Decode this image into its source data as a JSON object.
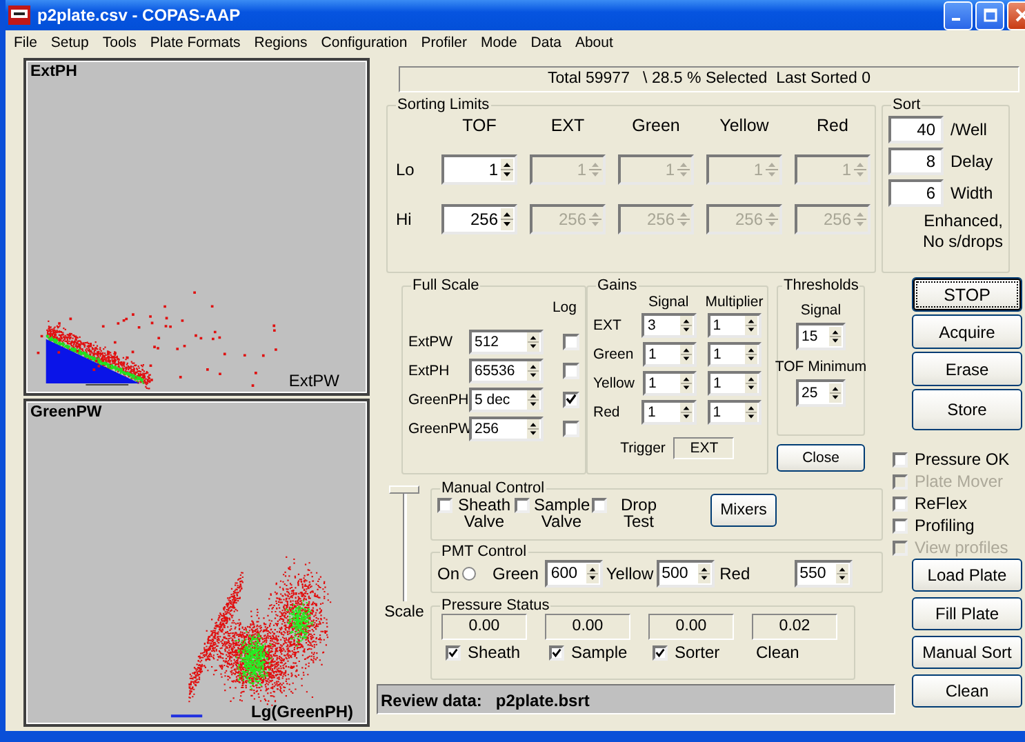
{
  "window": {
    "title": "p2plate.csv - COPAS-AAP"
  },
  "menu": [
    "File",
    "Setup",
    "Tools",
    "Plate Formats",
    "Regions",
    "Configuration",
    "Profiler",
    "Mode",
    "Data",
    "About"
  ],
  "plots": [
    {
      "kind": "wedge",
      "y_label": "ExtPH",
      "x_label": "ExtPW"
    },
    {
      "kind": "clusters",
      "y_label": "GreenPW",
      "x_label": "Lg(GreenPH)"
    }
  ],
  "status": "Total 59977   \\ 28.5 % Selected  Last Sorted 0",
  "sorting_limits": {
    "title": "Sorting Limits",
    "row_labels": [
      "Lo",
      "Hi"
    ],
    "columns": [
      {
        "label": "TOF",
        "lo": "1",
        "hi": "256",
        "disabled": false
      },
      {
        "label": "EXT",
        "lo": "1",
        "hi": "256",
        "disabled": true
      },
      {
        "label": "Green",
        "lo": "1",
        "hi": "256",
        "disabled": true
      },
      {
        "label": "Yellow",
        "lo": "1",
        "hi": "256",
        "disabled": true
      },
      {
        "label": "Red",
        "lo": "1",
        "hi": "256",
        "disabled": true
      }
    ]
  },
  "sort": {
    "title": "Sort",
    "fields": [
      {
        "value": "40",
        "label": "/Well"
      },
      {
        "value": "8",
        "label": "Delay"
      },
      {
        "value": "6",
        "label": "Width"
      }
    ],
    "note": "Enhanced, No s/drops"
  },
  "full_scale": {
    "title": "Full Scale",
    "log_label": "Log",
    "rows": [
      {
        "label": "ExtPW",
        "value": "512",
        "log": false
      },
      {
        "label": "ExtPH",
        "value": "65536",
        "log": false
      },
      {
        "label": "GreenPH",
        "value": "5 dec",
        "log": true
      },
      {
        "label": "GreenPW",
        "value": "256",
        "log": false
      }
    ]
  },
  "gains": {
    "title": "Gains",
    "columns": [
      "Signal",
      "Multiplier"
    ],
    "rows": [
      {
        "label": "EXT",
        "signal": "3",
        "multiplier": "1"
      },
      {
        "label": "Green",
        "signal": "1",
        "multiplier": "1"
      },
      {
        "label": "Yellow",
        "signal": "1",
        "multiplier": "1"
      },
      {
        "label": "Red",
        "signal": "1",
        "multiplier": "1"
      }
    ],
    "trigger_label": "Trigger",
    "trigger": "EXT"
  },
  "thresholds": {
    "title": "Thresholds",
    "signal_label": "Signal",
    "signal": "15",
    "tof_label": "TOF Minimum",
    "tof": "25"
  },
  "close_button": "Close",
  "action_buttons": [
    {
      "label": "STOP",
      "focused": true
    },
    {
      "label": "Acquire",
      "focused": false
    },
    {
      "label": "Erase",
      "focused": false
    },
    {
      "label": "Store",
      "focused": false
    }
  ],
  "options": [
    {
      "label": "Pressure OK",
      "checked": false,
      "disabled": false
    },
    {
      "label": "Plate Mover",
      "checked": false,
      "disabled": true
    },
    {
      "label": "ReFlex",
      "checked": false,
      "disabled": false
    },
    {
      "label": "Profiling",
      "checked": false,
      "disabled": false
    },
    {
      "label": "View profiles",
      "checked": false,
      "disabled": true
    }
  ],
  "plate_buttons": [
    "Load Plate",
    "Fill Plate",
    "Manual Sort",
    "Clean"
  ],
  "scale": {
    "label": "Scale",
    "level": 1
  },
  "manual_control": {
    "title": "Manual Control",
    "valves": [
      {
        "label": "Sheath Valve",
        "checked": false
      },
      {
        "label": "Sample Valve",
        "checked": false
      },
      {
        "label": "Drop Test",
        "checked": false
      }
    ],
    "mixers_button": "Mixers"
  },
  "pmt_control": {
    "title": "PMT Control",
    "on_label": "On",
    "on": false,
    "channels": [
      {
        "label": "Green",
        "value": "600"
      },
      {
        "label": "Yellow",
        "value": "500"
      },
      {
        "label": "Red",
        "value": "550"
      }
    ]
  },
  "pressure_status": {
    "title": "Pressure Status",
    "items": [
      {
        "kind": "checkbox",
        "reading": "0.00",
        "label": "Sheath",
        "checked": true
      },
      {
        "kind": "checkbox",
        "reading": "0.00",
        "label": "Sample",
        "checked": true
      },
      {
        "kind": "checkbox",
        "reading": "0.00",
        "label": "Sorter",
        "checked": true
      },
      {
        "kind": "text",
        "reading": "0.02",
        "label": "Clean"
      }
    ]
  },
  "review": "Review data:   p2plate.bsrt"
}
